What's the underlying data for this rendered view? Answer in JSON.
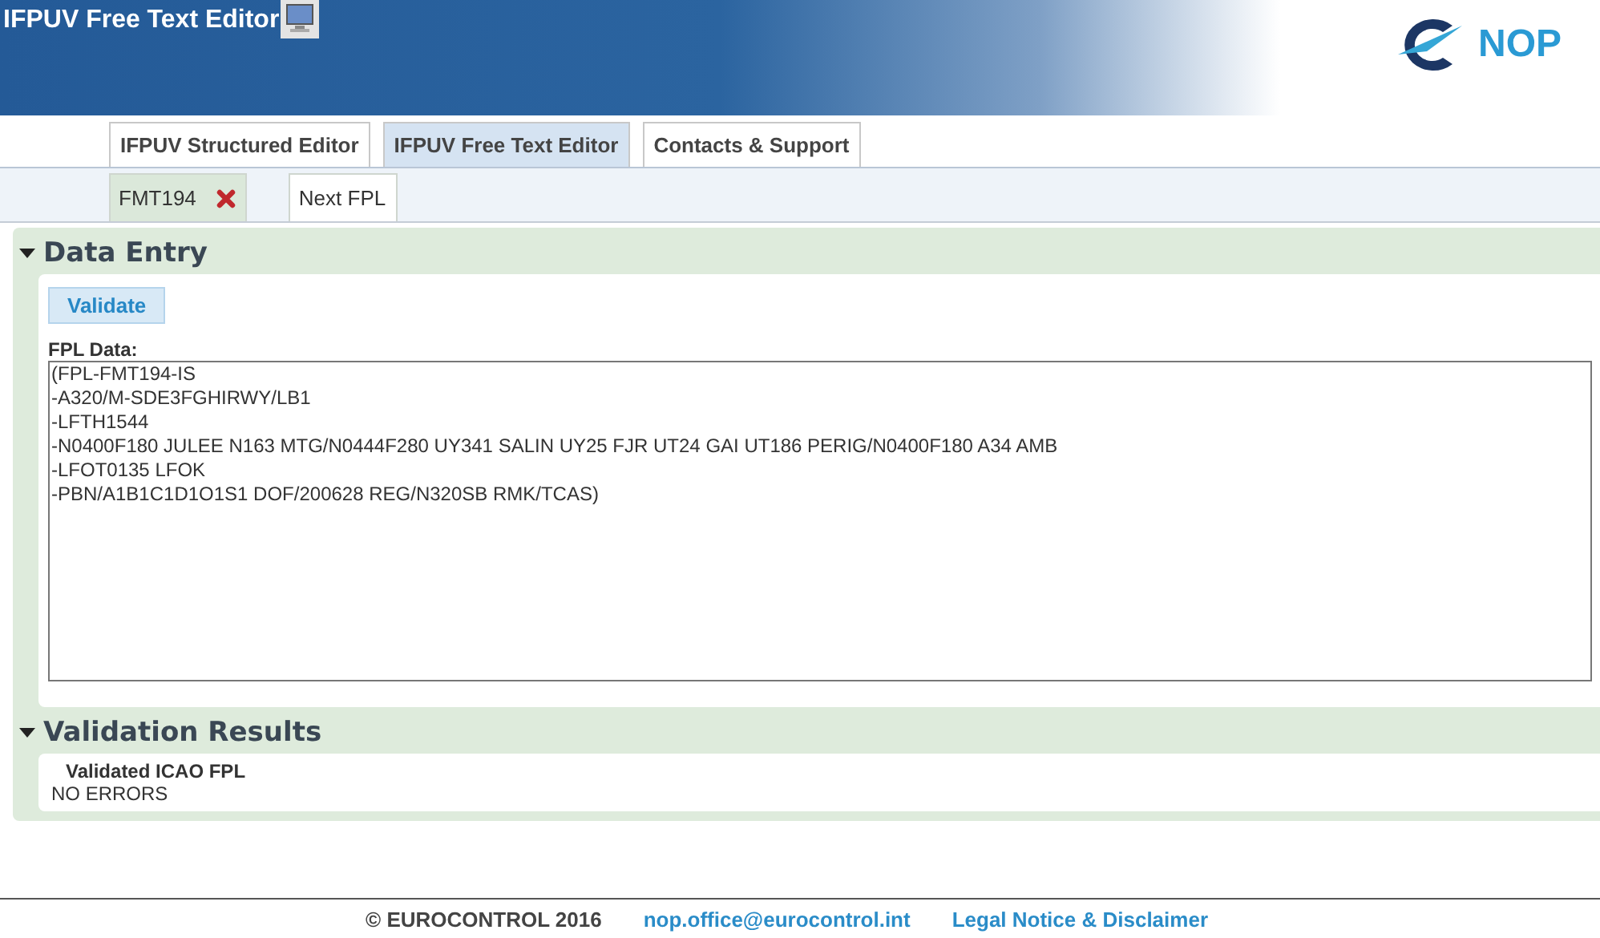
{
  "header": {
    "title": "IFPUV Free Text Editor",
    "logo_text": "NOP"
  },
  "tabs": [
    {
      "label": "IFPUV Structured Editor",
      "selected": false
    },
    {
      "label": "IFPUV Free Text Editor",
      "selected": true
    },
    {
      "label": "Contacts & Support",
      "selected": false
    }
  ],
  "subtabs": [
    {
      "label": "FMT194",
      "selected": true,
      "closable": true
    },
    {
      "label": "Next FPL",
      "selected": false,
      "closable": false
    }
  ],
  "data_entry": {
    "title": "Data Entry",
    "expanded": true,
    "validate_button": "Validate",
    "field_label": "FPL Data:",
    "fpl_lines": [
      "(FPL-FMT194-IS",
      "-A320/M-SDE3FGHIRWY/LB1",
      "-LFTH1544",
      "-N0400F180 JULEE N163 MTG/N0444F280 UY341 SALIN UY25 FJR UT24 GAI UT186 PERIG/N0400F180 A34 AMB",
      "-LFOT0135 LFOK",
      "-PBN/A1B1C1D1O1S1 DOF/200628 REG/N320SB RMK/TCAS)"
    ]
  },
  "validation_results": {
    "title": "Validation Results",
    "expanded": true,
    "heading": "Validated ICAO FPL",
    "result": "NO ERRORS"
  },
  "footer": {
    "copyright": "© EUROCONTROL 2016",
    "email": "nop.office@eurocontrol.int",
    "legal": "Legal Notice & Disclaimer"
  }
}
